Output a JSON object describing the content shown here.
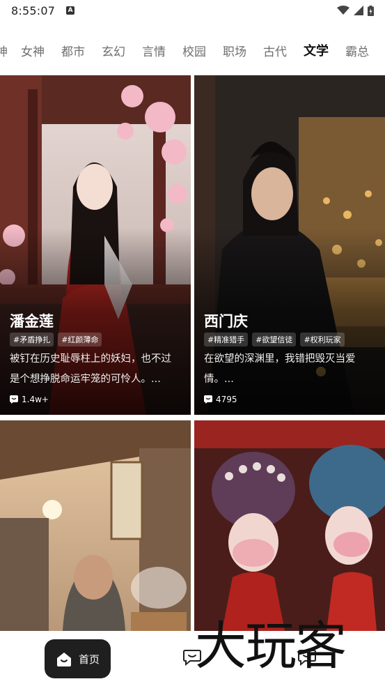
{
  "status": {
    "time": "8:55:07"
  },
  "tabs": [
    "神",
    "女神",
    "都市",
    "玄幻",
    "言情",
    "校园",
    "职场",
    "古代",
    "文学",
    "霸总"
  ],
  "active_tab": "文学",
  "accent_color": "#c7f26a",
  "cards": [
    {
      "title": "潘金莲",
      "tags": [
        "#矛盾挣扎",
        "#红颜薄命"
      ],
      "desc_line1": "被钉在历史耻辱柱上的妖妇，也不过",
      "desc_line2": "是个想挣脱命运牢笼的可怜人。...",
      "comments": "1.4w+"
    },
    {
      "title": "西门庆",
      "tags": [
        "#精准猎手",
        "#欲望信徒",
        "#权利玩家"
      ],
      "desc_line1": "在欲望的深渊里，我错把毁灭当爱",
      "desc_line2": "情。...",
      "comments": "4795"
    }
  ],
  "bottom_nav": {
    "home_label": "首页"
  },
  "watermark": "大玩客"
}
